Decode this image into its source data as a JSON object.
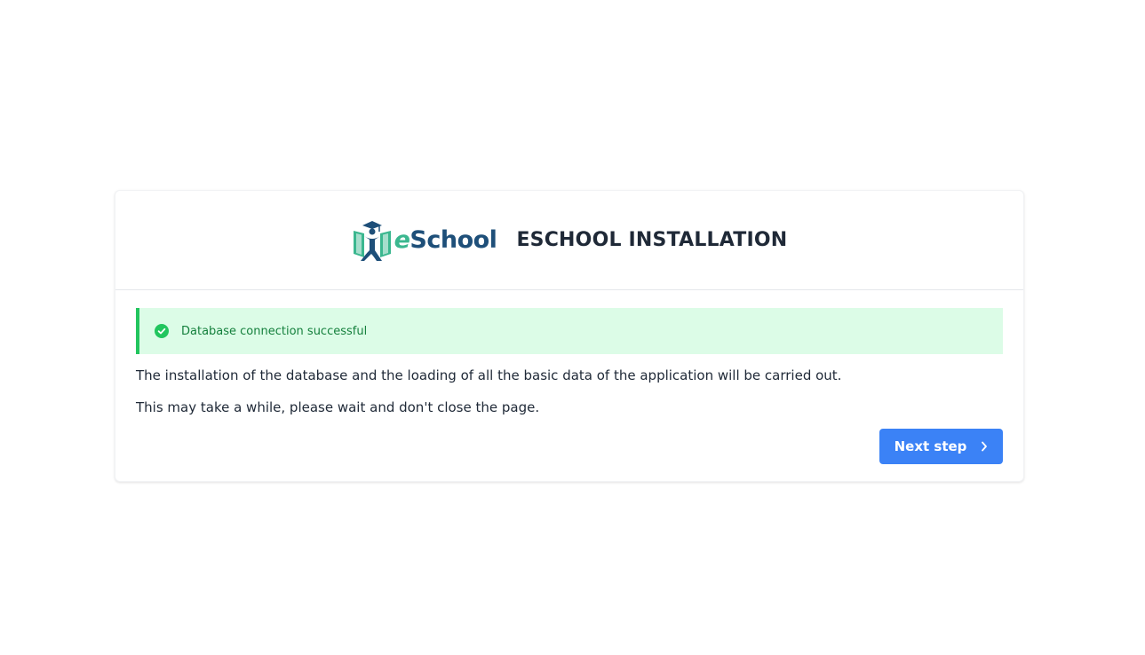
{
  "header": {
    "logo": {
      "text_e": "e",
      "text_rest": "School",
      "icon": "eschool-logo-icon"
    },
    "title": "ESCHOOL INSTALLATION"
  },
  "alert": {
    "icon": "check-circle-icon",
    "message": "Database connection successful"
  },
  "body": {
    "paragraph_1": "The installation of the database and the loading of all the basic data of the application will be carried out.",
    "paragraph_2": "This may take a while, please wait and don't close the page."
  },
  "actions": {
    "next_label": "Next step",
    "next_icon": "chevron-right-icon"
  },
  "colors": {
    "primary": "#3b82f6",
    "success_bg": "#dcfce7",
    "success_border": "#22c55e",
    "success_text": "#15803d",
    "brand_green": "#3bb78f",
    "brand_navy": "#1e4f79"
  }
}
